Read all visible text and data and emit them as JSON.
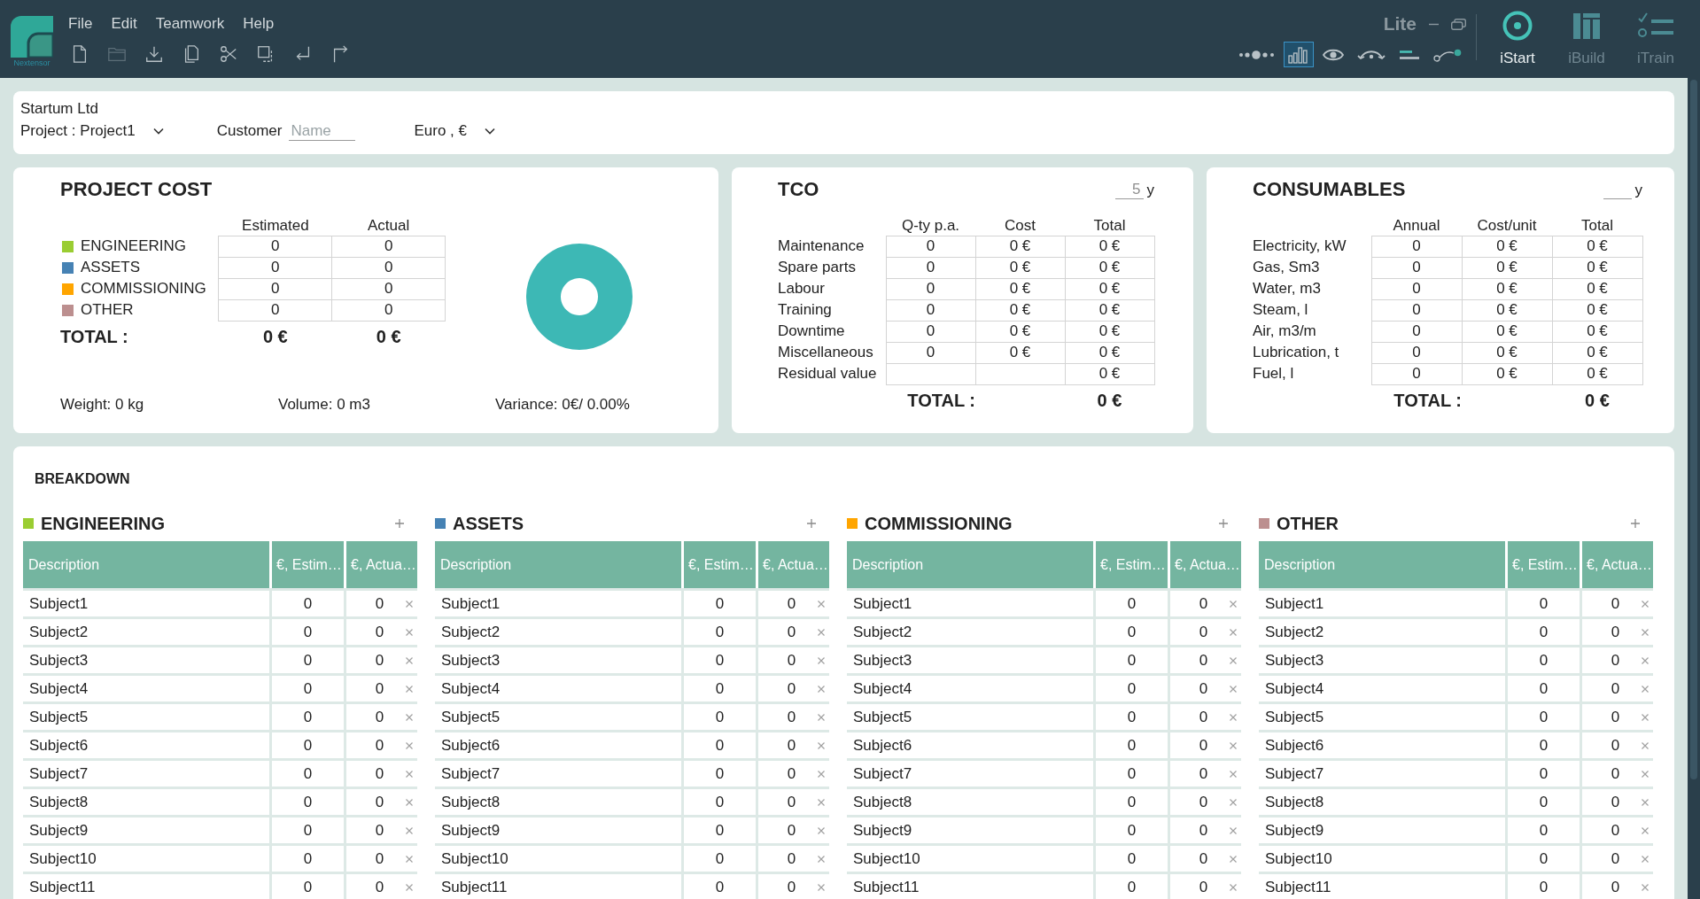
{
  "app_bar": {
    "logo_text": "Nextensor",
    "menu": [
      "File",
      "Edit",
      "Teamwork",
      "Help"
    ],
    "toolbar": [
      {
        "kind": "new",
        "disabled": false
      },
      {
        "kind": "open",
        "disabled": true
      },
      {
        "kind": "download",
        "disabled": false
      },
      {
        "kind": "copy",
        "disabled": false
      },
      {
        "kind": "cut",
        "disabled": false
      },
      {
        "kind": "select",
        "disabled": false
      },
      {
        "kind": "enter",
        "disabled": false
      },
      {
        "kind": "redo",
        "disabled": false
      }
    ],
    "edition": "Lite",
    "view_modes": [
      {
        "kind": "timeline",
        "selected": false
      },
      {
        "kind": "chart",
        "selected": true
      },
      {
        "kind": "preview",
        "selected": false
      },
      {
        "kind": "flow",
        "selected": false
      },
      {
        "kind": "align",
        "selected": false
      },
      {
        "kind": "connector",
        "selected": false
      }
    ],
    "modules": [
      {
        "kind": "target",
        "label": "iStart",
        "selected": true
      },
      {
        "kind": "columns",
        "label": "iBuild",
        "selected": false
      },
      {
        "kind": "checklist",
        "label": "iTrain",
        "selected": false
      }
    ]
  },
  "header": {
    "company": "Startum Ltd",
    "project_label": "Project :",
    "project": "Project1",
    "customer_label": "Customer",
    "customer": {
      "placeholder": "Name"
    },
    "currency": "Euro , €"
  },
  "project_cost": {
    "title": "PROJECT COST",
    "columns": [
      "Estimated",
      "Actual"
    ],
    "rows": [
      {
        "label": "ENGINEERING",
        "color": "#9acd32",
        "estimated": "0",
        "actual": "0"
      },
      {
        "label": "ASSETS",
        "color": "#4682b4",
        "estimated": "0",
        "actual": "0"
      },
      {
        "label": "COMMISSIONING",
        "color": "#ffa500",
        "estimated": "0",
        "actual": "0"
      },
      {
        "label": "OTHER",
        "color": "#bc8f8f",
        "estimated": "0",
        "actual": "0"
      }
    ],
    "total": {
      "label": "TOTAL :",
      "estimated": "0 €",
      "actual": "0 €"
    },
    "footer": [
      "Weight: 0 kg",
      "Volume: 0 m3",
      "Variance: 0€/ 0.00%"
    ]
  },
  "tco": {
    "title": "TCO",
    "period": {
      "placeholder": "5",
      "unit": "y"
    },
    "columns": [
      "Q-ty p.a.",
      "Cost",
      "Total"
    ],
    "rows": [
      {
        "label": "Maintenance",
        "qty": "0",
        "cost": "0 €",
        "total": "0 €"
      },
      {
        "label": "Spare parts",
        "qty": "0",
        "cost": "0 €",
        "total": "0 €"
      },
      {
        "label": "Labour",
        "qty": "0",
        "cost": "0 €",
        "total": "0 €"
      },
      {
        "label": "Training",
        "qty": "0",
        "cost": "0 €",
        "total": "0 €"
      },
      {
        "label": "Downtime",
        "qty": "0",
        "cost": "0 €",
        "total": "0 €"
      },
      {
        "label": "Miscellaneous",
        "qty": "0",
        "cost": "0 €",
        "total": "0 €"
      },
      {
        "label": "Residual value",
        "total": "0 €"
      }
    ],
    "total": {
      "label": "TOTAL :",
      "value": "0 €"
    }
  },
  "consumables": {
    "title": "CONSUMABLES",
    "period": {
      "unit": "y"
    },
    "columns": [
      "Annual",
      "Cost/unit",
      "Total"
    ],
    "rows": [
      {
        "label": "Electricity, kW",
        "annual": "0",
        "cost_per_unit": "0 €",
        "total": "0 €"
      },
      {
        "label": "Gas, Sm3",
        "annual": "0",
        "cost_per_unit": "0 €",
        "total": "0 €"
      },
      {
        "label": "Water, m3",
        "annual": "0",
        "cost_per_unit": "0 €",
        "total": "0 €"
      },
      {
        "label": "Steam, l",
        "annual": "0",
        "cost_per_unit": "0 €",
        "total": "0 €"
      },
      {
        "label": "Air, m3/m",
        "annual": "0",
        "cost_per_unit": "0 €",
        "total": "0 €"
      },
      {
        "label": "Lubrication, t",
        "annual": "0",
        "cost_per_unit": "0 €",
        "total": "0 €"
      },
      {
        "label": "Fuel, l",
        "annual": "0",
        "cost_per_unit": "0 €",
        "total": "0 €"
      }
    ],
    "total": {
      "label": "TOTAL :",
      "value": "0 €"
    }
  },
  "breakdown": {
    "title": "BREAKDOWN",
    "groups": [
      {
        "name": "ENGINEERING",
        "color": "#9acd32",
        "columns": [
          "Description",
          "€, Estim…",
          "€, Actua…"
        ],
        "rows": [
          {
            "description": "Subject1",
            "estimated": "0",
            "actual": "0"
          },
          {
            "description": "Subject2",
            "estimated": "0",
            "actual": "0"
          },
          {
            "description": "Subject3",
            "estimated": "0",
            "actual": "0"
          },
          {
            "description": "Subject4",
            "estimated": "0",
            "actual": "0"
          },
          {
            "description": "Subject5",
            "estimated": "0",
            "actual": "0"
          },
          {
            "description": "Subject6",
            "estimated": "0",
            "actual": "0"
          },
          {
            "description": "Subject7",
            "estimated": "0",
            "actual": "0"
          },
          {
            "description": "Subject8",
            "estimated": "0",
            "actual": "0"
          },
          {
            "description": "Subject9",
            "estimated": "0",
            "actual": "0"
          },
          {
            "description": "Subject10",
            "estimated": "0",
            "actual": "0"
          },
          {
            "description": "Subject11",
            "estimated": "0",
            "actual": "0"
          }
        ]
      },
      {
        "name": "ASSETS",
        "color": "#4682b4",
        "columns": [
          "Description",
          "€, Estim…",
          "€, Actua…"
        ],
        "rows": [
          {
            "description": "Subject1",
            "estimated": "0",
            "actual": "0"
          },
          {
            "description": "Subject2",
            "estimated": "0",
            "actual": "0"
          },
          {
            "description": "Subject3",
            "estimated": "0",
            "actual": "0"
          },
          {
            "description": "Subject4",
            "estimated": "0",
            "actual": "0"
          },
          {
            "description": "Subject5",
            "estimated": "0",
            "actual": "0"
          },
          {
            "description": "Subject6",
            "estimated": "0",
            "actual": "0"
          },
          {
            "description": "Subject7",
            "estimated": "0",
            "actual": "0"
          },
          {
            "description": "Subject8",
            "estimated": "0",
            "actual": "0"
          },
          {
            "description": "Subject9",
            "estimated": "0",
            "actual": "0"
          },
          {
            "description": "Subject10",
            "estimated": "0",
            "actual": "0"
          },
          {
            "description": "Subject11",
            "estimated": "0",
            "actual": "0"
          }
        ]
      },
      {
        "name": "COMMISSIONING",
        "color": "#ffa500",
        "columns": [
          "Description",
          "€, Estim…",
          "€, Actua…"
        ],
        "rows": [
          {
            "description": "Subject1",
            "estimated": "0",
            "actual": "0"
          },
          {
            "description": "Subject2",
            "estimated": "0",
            "actual": "0"
          },
          {
            "description": "Subject3",
            "estimated": "0",
            "actual": "0"
          },
          {
            "description": "Subject4",
            "estimated": "0",
            "actual": "0"
          },
          {
            "description": "Subject5",
            "estimated": "0",
            "actual": "0"
          },
          {
            "description": "Subject6",
            "estimated": "0",
            "actual": "0"
          },
          {
            "description": "Subject7",
            "estimated": "0",
            "actual": "0"
          },
          {
            "description": "Subject8",
            "estimated": "0",
            "actual": "0"
          },
          {
            "description": "Subject9",
            "estimated": "0",
            "actual": "0"
          },
          {
            "description": "Subject10",
            "estimated": "0",
            "actual": "0"
          },
          {
            "description": "Subject11",
            "estimated": "0",
            "actual": "0"
          }
        ]
      },
      {
        "name": "OTHER",
        "color": "#bc8f8f",
        "columns": [
          "Description",
          "€, Estim…",
          "€, Actua…"
        ],
        "rows": [
          {
            "description": "Subject1",
            "estimated": "0",
            "actual": "0"
          },
          {
            "description": "Subject2",
            "estimated": "0",
            "actual": "0"
          },
          {
            "description": "Subject3",
            "estimated": "0",
            "actual": "0"
          },
          {
            "description": "Subject4",
            "estimated": "0",
            "actual": "0"
          },
          {
            "description": "Subject5",
            "estimated": "0",
            "actual": "0"
          },
          {
            "description": "Subject6",
            "estimated": "0",
            "actual": "0"
          },
          {
            "description": "Subject7",
            "estimated": "0",
            "actual": "0"
          },
          {
            "description": "Subject8",
            "estimated": "0",
            "actual": "0"
          },
          {
            "description": "Subject9",
            "estimated": "0",
            "actual": "0"
          },
          {
            "description": "Subject10",
            "estimated": "0",
            "actual": "0"
          },
          {
            "description": "Subject11",
            "estimated": "0",
            "actual": "0"
          }
        ]
      }
    ]
  }
}
